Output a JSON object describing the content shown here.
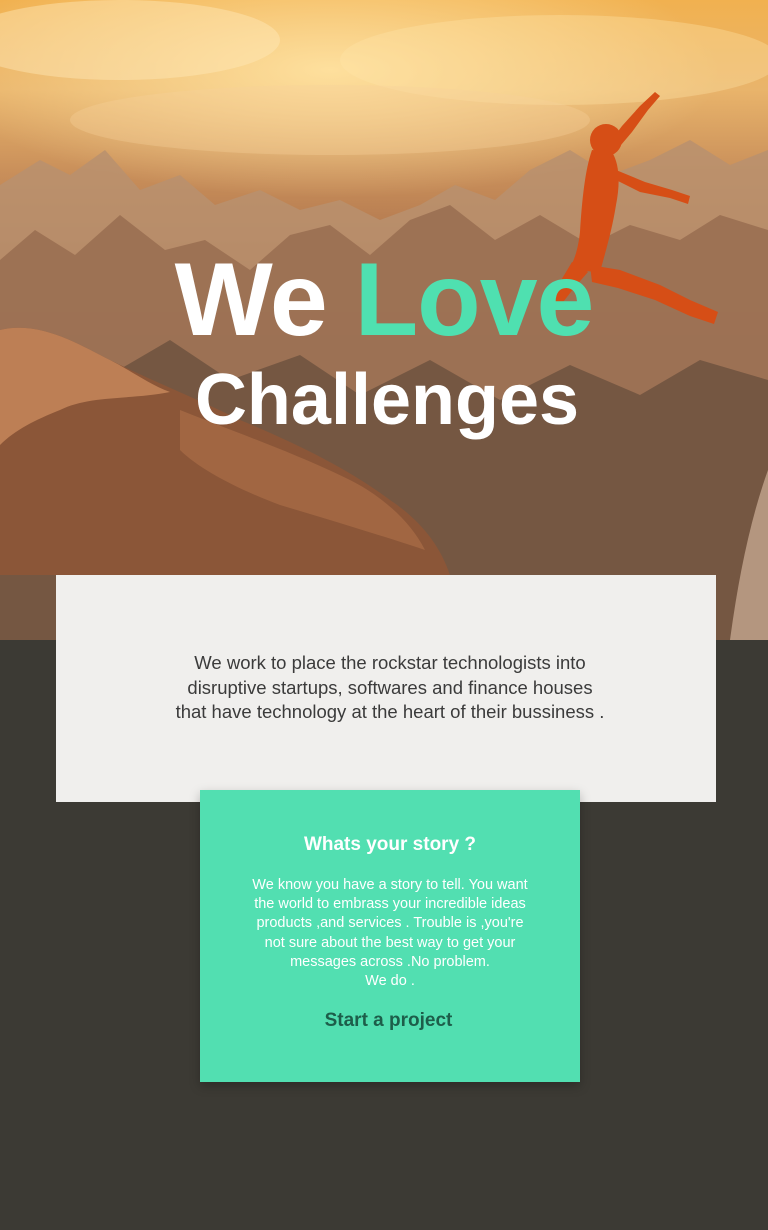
{
  "hero": {
    "headline_word1": "We",
    "headline_word2": "Love",
    "headline_line2": "Challenges",
    "background_description": "",
    "accent_color": "#4fe0b0"
  },
  "intro": {
    "lines": [
      "We work to place the rockstar technologists into",
      "disruptive startups, softwares and finance houses",
      "that have technology at the heart of their bussiness ."
    ]
  },
  "story": {
    "title": "Whats your story ?",
    "body_lines": [
      "We know you have a story to tell. You want",
      "the world to embrass your incredible ideas",
      "products ,and services . Trouble is ,you're",
      "not sure about the best way to get your",
      "messages across .No problem.",
      "We do ."
    ],
    "cta_label": "Start a project",
    "bg_color": "#52dfb1",
    "cta_color": "#1d5e4a"
  },
  "icons": {
    "hero_image": "mountain-jumper-photo"
  }
}
